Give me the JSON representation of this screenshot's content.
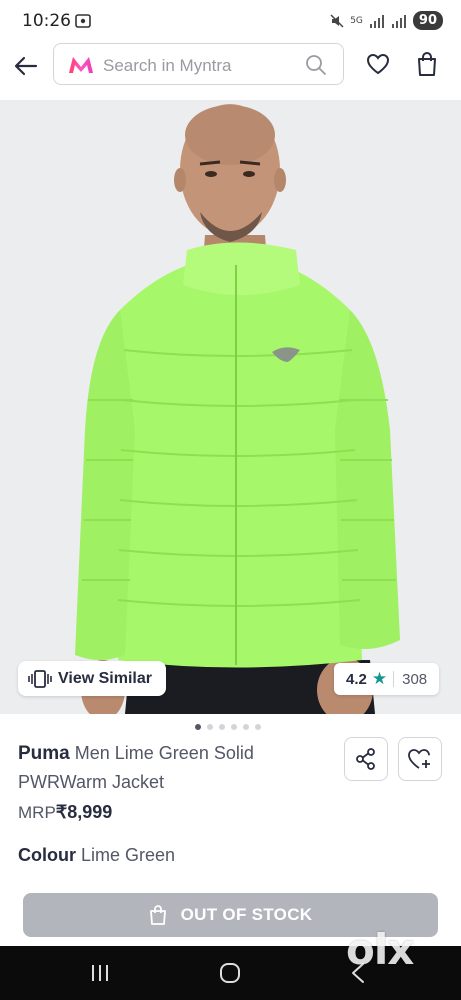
{
  "status_bar": {
    "time": "10:26",
    "network": "5G",
    "battery": "90"
  },
  "header": {
    "search_placeholder": "Search in Myntra",
    "icons": [
      "back-arrow-icon",
      "myntra-logo",
      "search-icon",
      "heart-icon",
      "bag-icon"
    ]
  },
  "gallery": {
    "view_similar_label": "View Similar",
    "rating": "4.2",
    "rating_count": "308",
    "dots_total": 6,
    "active_dot": 0
  },
  "product": {
    "brand": "Puma",
    "name": "Men Lime Green Solid PWRWarm Jacket",
    "mrp_label": "MRP",
    "price": "₹8,999",
    "colour_label": "Colour",
    "colour_value": "Lime Green"
  },
  "cta": {
    "label": "OUT OF STOCK"
  },
  "watermark": "olx",
  "colors": {
    "accent_green": "#14958f",
    "disabled_btn": "#b3b5bc",
    "jacket": "#a6f86a"
  }
}
